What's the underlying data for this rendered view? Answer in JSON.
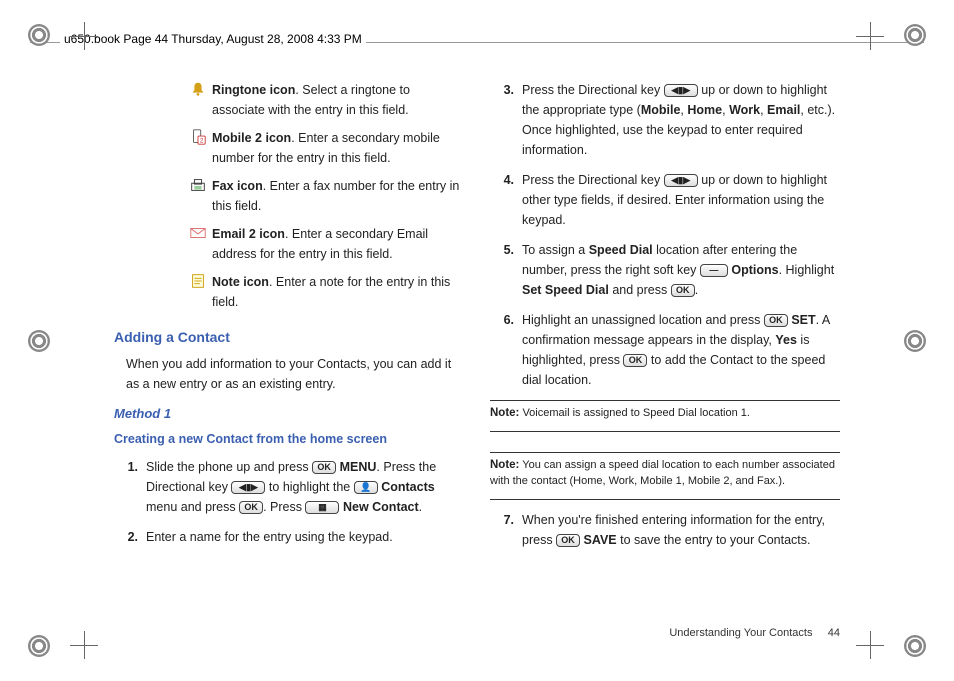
{
  "header": "u650.book  Page 44  Thursday, August 28, 2008  4:33 PM",
  "icons": {
    "ringtone": {
      "label": "Ringtone icon",
      "desc": ". Select a ringtone to associate with the entry in this field."
    },
    "mobile2": {
      "label": "Mobile 2 icon",
      "desc": ". Enter a secondary mobile number for the entry in this field."
    },
    "fax": {
      "label": "Fax icon",
      "desc": ". Enter a fax number for the entry in this field."
    },
    "email2": {
      "label": "Email 2 icon",
      "desc": ". Enter a secondary Email address for the entry in this field."
    },
    "note": {
      "label": "Note icon",
      "desc": ". Enter a note for the entry in this field."
    }
  },
  "h_adding": "Adding a Contact",
  "adding_intro": "When you add information to your Contacts, you can add it as a new entry or as an existing entry.",
  "h_method1": "Method 1",
  "h_creating": "Creating a new Contact from the home screen",
  "steps": {
    "s1a": "Slide the phone up and press ",
    "s1b": ". Press the Directional key ",
    "s1c": " to highlight the ",
    "s1d": " menu and press ",
    "s1e": ". Press ",
    "s1f": ".",
    "menu": "MENU",
    "contacts": "Contacts",
    "newcontact": "New Contact",
    "s2": "Enter a name for the entry using the keypad.",
    "s3a": "Press the Directional key ",
    "s3b": " up or down to highlight the appropriate type (",
    "s3c": ", etc.). Once highlighted, use the keypad to enter required information.",
    "mobile": "Mobile",
    "home": "Home",
    "work": "Work",
    "email": "Email",
    "s4a": "Press the Directional key ",
    "s4b": " up or down to highlight other type fields, if desired. Enter information using the keypad.",
    "s5a": "To assign a ",
    "speeddial": "Speed Dial",
    "s5b": " location after entering the number, press the right soft key ",
    "options": "Options",
    "s5c": ". Highlight ",
    "setspeed": "Set Speed Dial",
    "s5d": " and press ",
    "s5e": ".",
    "s6a": "Highlight an unassigned location and press ",
    "set": "SET",
    "s6b": ". A confirmation message appears in the display, ",
    "yes": "Yes",
    "s6c": " is highlighted, press ",
    "s6d": " to add the Contact to the speed dial location.",
    "s7a": "When you're finished entering information for the entry, press ",
    "save": "SAVE",
    "s7b": " to save the entry to your Contacts."
  },
  "note1_label": "Note:",
  "note1": " Voicemail is assigned to Speed Dial location 1.",
  "note2_label": "Note:",
  "note2": " You can assign a speed dial location to each number associated with the contact (Home, Work, Mobile 1, Mobile 2, and Fax.).",
  "footer_section": "Understanding Your Contacts",
  "footer_page": "44",
  "keys": {
    "ok": "OK",
    "nav": "◀▮▶",
    "dash": "—",
    "icon": "▦",
    "contacts_icon": "👤"
  }
}
